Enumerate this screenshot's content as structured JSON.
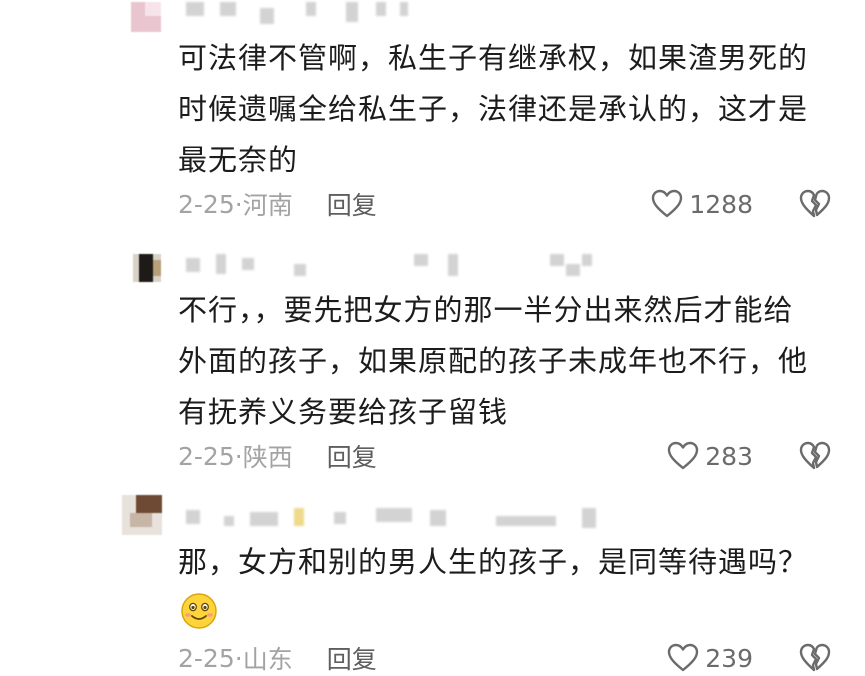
{
  "comments": [
    {
      "text_lines": [
        "可法律不管啊，私生子有继承权，如果渣男死的",
        "时候遗嘱全给私生子，法律还是承认的，这才是",
        "最无奈的"
      ],
      "date": "2-25",
      "location": "河南",
      "reply_label": "回复",
      "likes": "1288",
      "has_emoji": false
    },
    {
      "text_lines": [
        "不行，，要先把女方的那一半分出来然后才能给",
        "外面的孩子，如果原配的孩子未成年也不行，他",
        "有抚养义务要给孩子留钱"
      ],
      "date": "2-25",
      "location": "陕西",
      "reply_label": "回复",
      "likes": "283",
      "has_emoji": false
    },
    {
      "text_lines": [
        "那，女方和别的男人生的孩子，是同等待遇吗？"
      ],
      "date": "2-25",
      "location": "山东",
      "reply_label": "回复",
      "likes": "239",
      "has_emoji": true
    }
  ],
  "icons": {
    "like": "heart-outline-icon",
    "dislike": "broken-heart-icon",
    "emoji": "smile-emoji-icon"
  },
  "colors": {
    "text": "#1c1c1c",
    "meta": "#a3a3a3",
    "reply": "#5e5e5e",
    "icon": "#6b6b6b"
  }
}
